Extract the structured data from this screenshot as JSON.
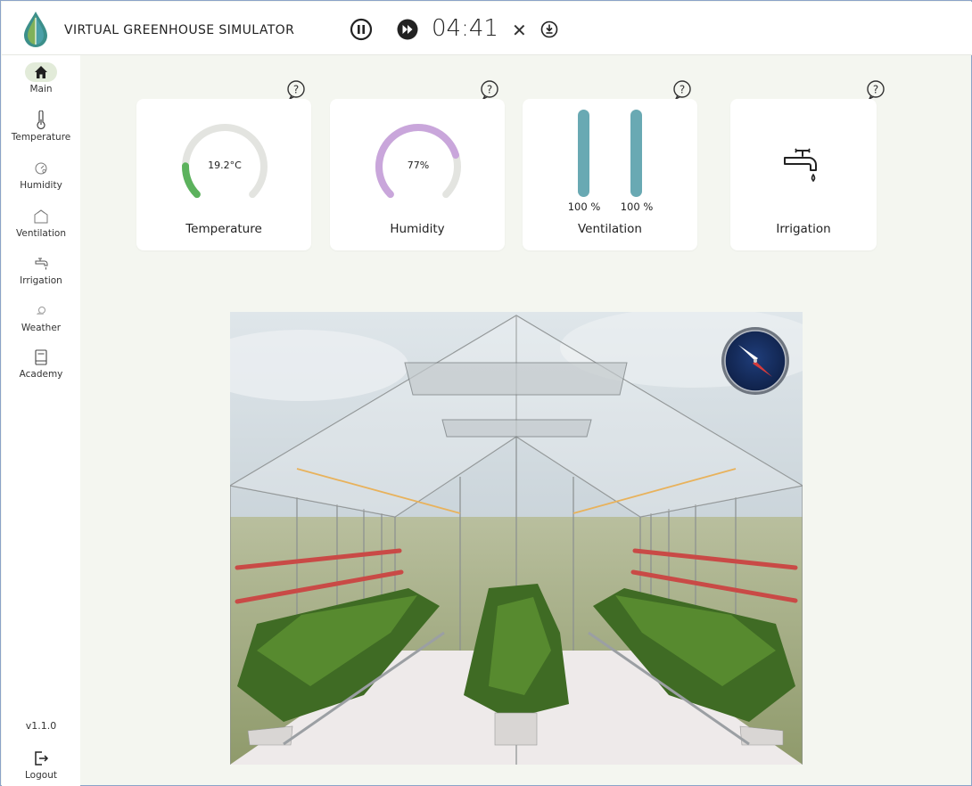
{
  "app": {
    "title": "VIRTUAL GREENHOUSE SIMULATOR",
    "timer": "04:41"
  },
  "sidebar": {
    "items": [
      {
        "label": "Main",
        "icon": "home-icon",
        "active": true
      },
      {
        "label": "Temperature",
        "icon": "thermometer-icon"
      },
      {
        "label": "Humidity",
        "icon": "humidity-gauge-icon"
      },
      {
        "label": "Ventilation",
        "icon": "ventilation-icon"
      },
      {
        "label": "Irrigation",
        "icon": "faucet-icon"
      },
      {
        "label": "Weather",
        "icon": "weather-icon"
      },
      {
        "label": "Academy",
        "icon": "book-icon"
      }
    ],
    "version": "v1.1.0",
    "logout": "Logout"
  },
  "cards": {
    "temperature": {
      "title": "Temperature",
      "value": "19.2°C",
      "level": 0.17,
      "color": "#5cb25d"
    },
    "humidity": {
      "title": "Humidity",
      "value": "77%",
      "level": 0.77,
      "color": "#c9a6db"
    },
    "ventilation": {
      "title": "Ventilation",
      "left": "100 %",
      "right": "100 %",
      "left_level": 1.0,
      "right_level": 1.0,
      "color": "#69a9b3"
    },
    "irrigation": {
      "title": "Irrigation"
    }
  },
  "colors": {
    "accent_green": "#5cb25d",
    "track": "#e5e5e1",
    "heater": "#c94a46"
  }
}
